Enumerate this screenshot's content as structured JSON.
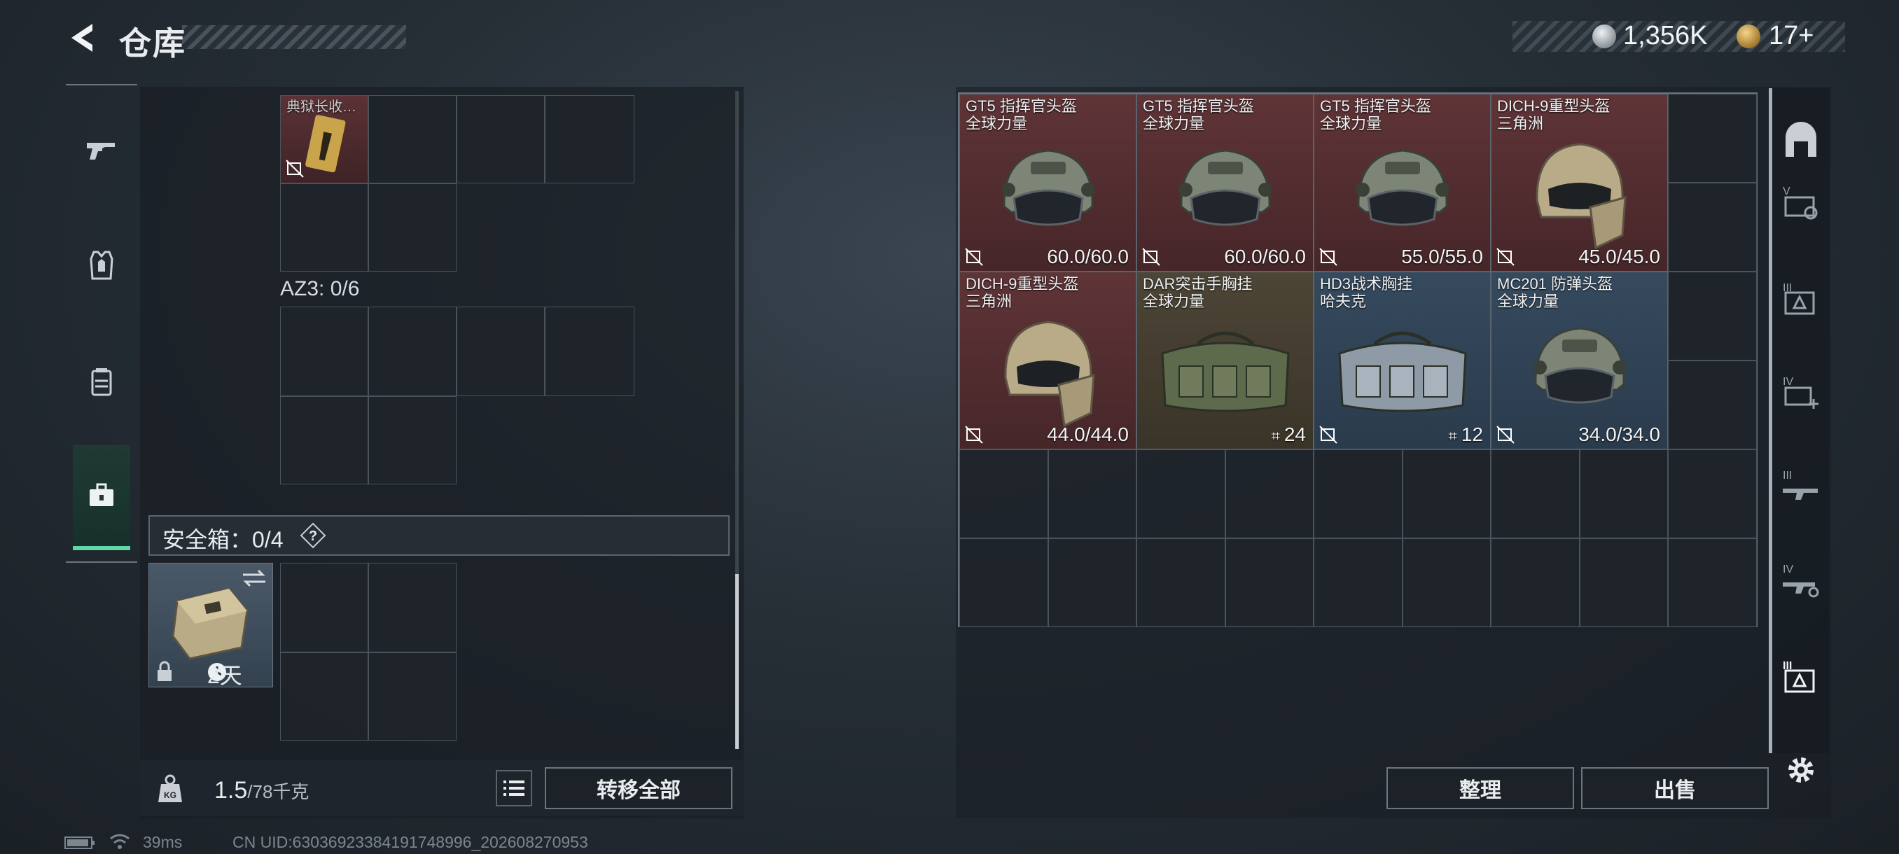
{
  "header": {
    "title": "仓库"
  },
  "currency": {
    "silver": "1,356K",
    "gold": "17+"
  },
  "left": {
    "az3_label": "AZ3: 0/6",
    "top_item_name": "典狱长收…",
    "safebox_label": "安全箱：0/4",
    "help_symbol": "?",
    "safebox_time": "2天",
    "weight_current": "1.5",
    "weight_max": "/78千克",
    "weight_icon_text": "KG",
    "transfer_all": "转移全部"
  },
  "status": {
    "ping": "39ms",
    "uid": "CN UID:6303692338419174899​6_202608270953"
  },
  "stash": {
    "items": [
      {
        "line1": "GT5 指挥官头盔",
        "line2": "全球力量",
        "value": "60.0/60.0",
        "rarity": "red",
        "type": "helmet"
      },
      {
        "line1": "GT5 指挥官头盔",
        "line2": "全球力量",
        "value": "60.0/60.0",
        "rarity": "red",
        "type": "helmet"
      },
      {
        "line1": "GT5 指挥官头盔",
        "line2": "全球力量",
        "value": "55.0/55.0",
        "rarity": "red",
        "type": "helmet"
      },
      {
        "line1": "DICH-9重型头盔",
        "line2": "三角洲",
        "value": "45.0/45.0",
        "rarity": "red",
        "type": "heavy-helmet"
      },
      {
        "line1": "DICH-9重型头盔",
        "line2": "三角洲",
        "value": "44.0/44.0",
        "rarity": "red",
        "type": "heavy-helmet"
      },
      {
        "line1": "DAR突击手胸挂",
        "line2": "全球力量",
        "value": "24",
        "rarity": "brown",
        "type": "rig"
      },
      {
        "line1": "HD3战术胸挂",
        "line2": "哈夫克",
        "value": "12",
        "rarity": "blue",
        "type": "rig"
      },
      {
        "line1": "MC201 防弹头盔",
        "line2": "全球力量",
        "value": "34.0/34.0",
        "rarity": "blue",
        "type": "helmet"
      }
    ]
  },
  "buttons": {
    "sort": "整理",
    "sell": "出售"
  }
}
